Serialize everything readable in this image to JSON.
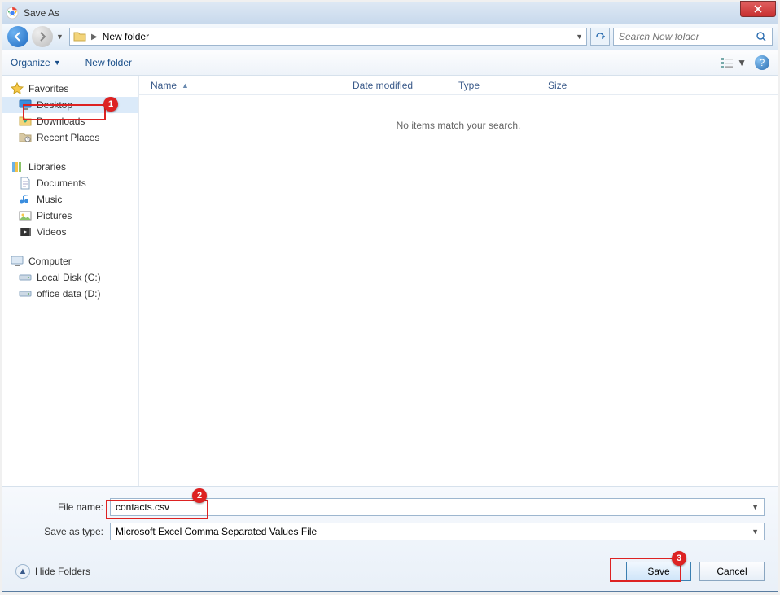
{
  "window": {
    "title": "Save As"
  },
  "nav": {
    "path_segment": "New folder",
    "search_placeholder": "Search New folder"
  },
  "toolbar": {
    "organize": "Organize",
    "new_folder": "New folder"
  },
  "sidebar": {
    "favorites": {
      "label": "Favorites",
      "items": [
        "Desktop",
        "Downloads",
        "Recent Places"
      ]
    },
    "libraries": {
      "label": "Libraries",
      "items": [
        "Documents",
        "Music",
        "Pictures",
        "Videos"
      ]
    },
    "computer": {
      "label": "Computer",
      "items": [
        "Local Disk (C:)",
        "office data (D:)"
      ]
    }
  },
  "columns": {
    "name": "Name",
    "date": "Date modified",
    "type": "Type",
    "size": "Size"
  },
  "content": {
    "empty": "No items match your search."
  },
  "form": {
    "filename_label": "File name:",
    "filename_value": "contacts.csv",
    "savetype_label": "Save as type:",
    "savetype_value": "Microsoft Excel Comma Separated Values File"
  },
  "footer": {
    "hide_folders": "Hide Folders",
    "save": "Save",
    "cancel": "Cancel"
  },
  "annotations": {
    "a1": "1",
    "a2": "2",
    "a3": "3"
  }
}
